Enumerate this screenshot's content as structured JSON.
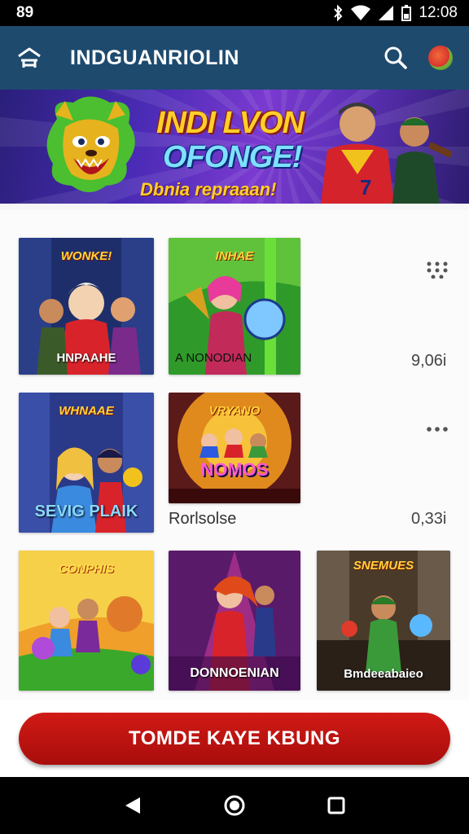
{
  "status_bar": {
    "left": "89",
    "time": "12:08"
  },
  "app_bar": {
    "title": "INDGUANRIOLIN"
  },
  "banner": {
    "line1": "INDI LVON",
    "line2": "OFONGE!",
    "line3": "Dbnia repraaan!"
  },
  "grid": {
    "row1": {
      "tiles": [
        {
          "title": "WONKE!",
          "caption": "HNPAAHE"
        },
        {
          "title": "INHAE",
          "caption": "A  NONODIAN"
        }
      ],
      "count": "9,06i"
    },
    "row2": {
      "tiles": [
        {
          "title": "WHNAAE",
          "caption": "SEVIG PLAIK"
        },
        {
          "title": "VRYANO",
          "caption": "NOMOS"
        }
      ],
      "label": "Rorlsolse",
      "count": "0,33i"
    },
    "row3": {
      "tiles": [
        {
          "title": "CONPHIS",
          "caption": ""
        },
        {
          "title": "",
          "caption": "DONNOENIAN"
        },
        {
          "title": "SNEMUES",
          "caption": "Bmdeeabaieo"
        }
      ]
    }
  },
  "cta": {
    "label": "TOMDE KAYE KBUNG"
  },
  "icons": {
    "menu": "home-lines-icon",
    "search": "search-icon",
    "avatar": "profile-avatar-icon",
    "more_grid": "grid-dots-icon",
    "more": "more-horizontal-icon",
    "back": "back-triangle-icon",
    "home": "home-circle-icon",
    "recents": "recents-square-icon"
  },
  "colors": {
    "app_bar": "#1e4a6e",
    "cta": "#c4130f"
  }
}
